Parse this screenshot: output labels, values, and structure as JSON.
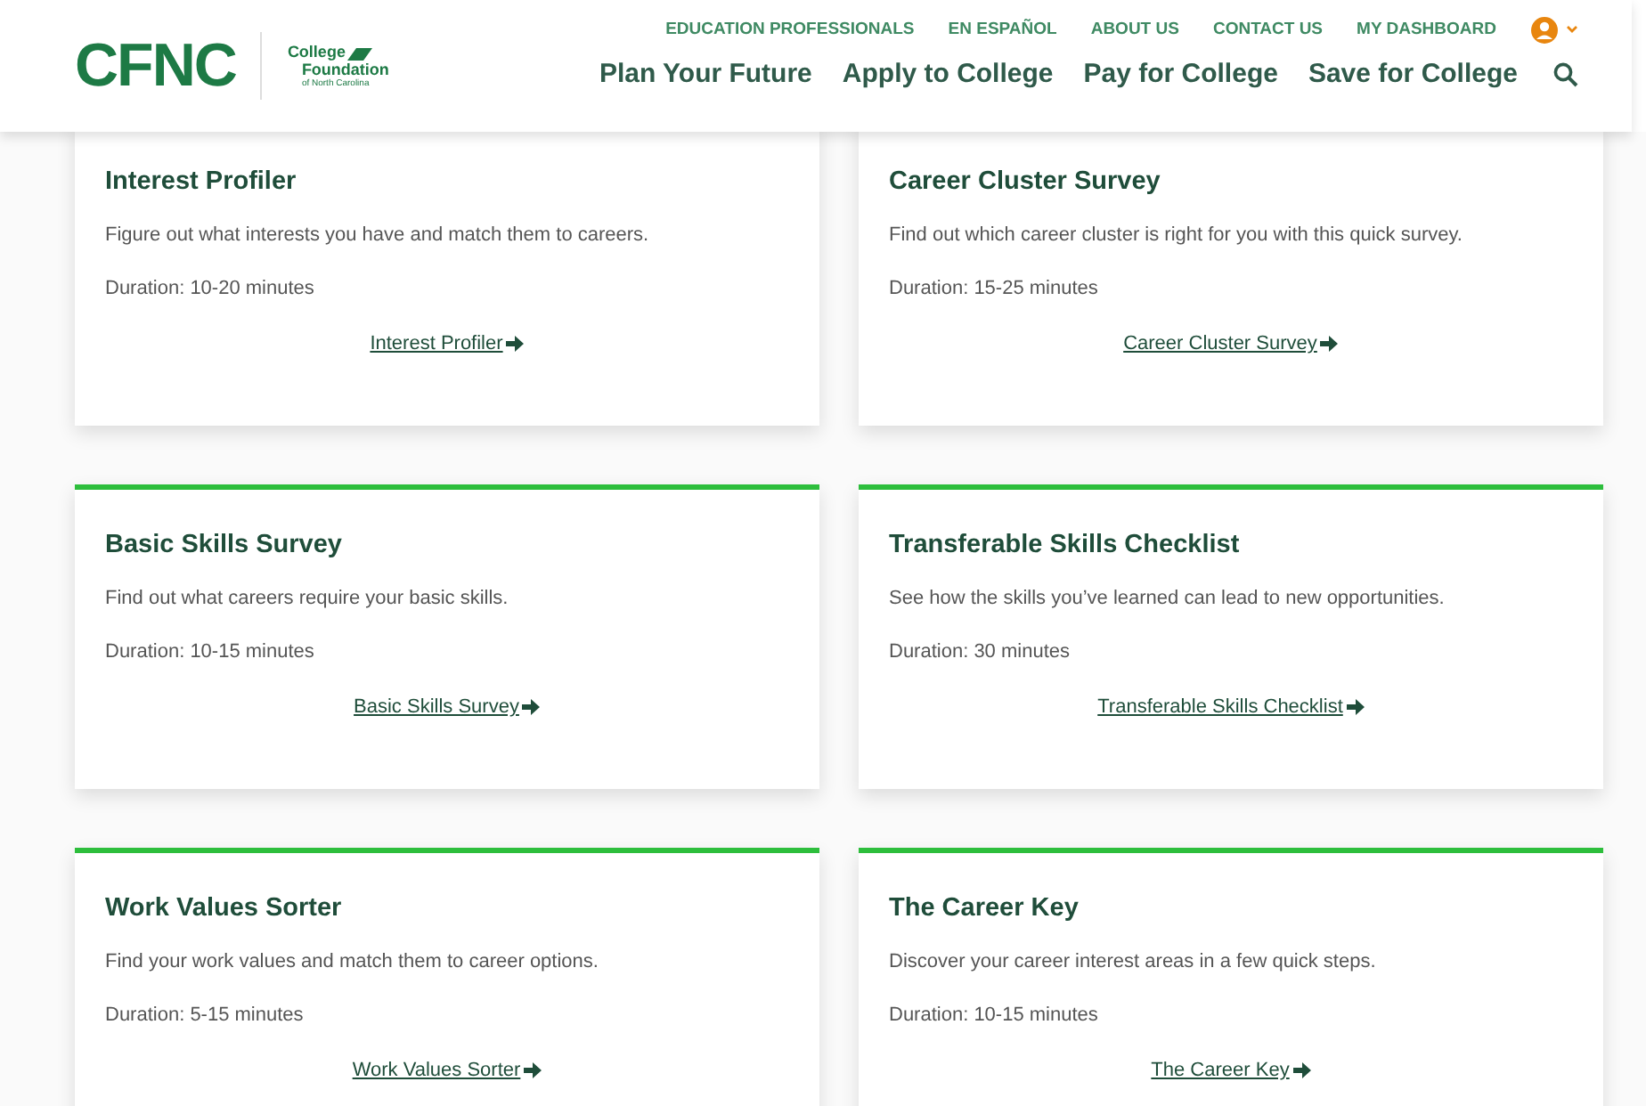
{
  "header": {
    "logo": "CFNC",
    "logo_sub": [
      "College",
      "Foundation",
      "of North Carolina"
    ],
    "utility_links": [
      "EDUCATION PROFESSIONALS",
      "EN ESPAÑOL",
      "ABOUT US",
      "CONTACT US",
      "MY DASHBOARD"
    ],
    "main_nav": [
      "Plan Your Future",
      "Apply to College",
      "Pay for College",
      "Save for College"
    ]
  },
  "cards": [
    {
      "title": "Interest Profiler",
      "description": "Figure out what interests you have and match them to careers.",
      "duration": "Duration: 10-20 minutes",
      "link": "Interest Profiler"
    },
    {
      "title": "Career Cluster Survey",
      "description": "Find out which career cluster is right for you with this quick survey.",
      "duration": "Duration: 15-25 minutes",
      "link": "Career Cluster Survey"
    },
    {
      "title": "Basic Skills Survey",
      "description": "Find out what careers require your basic skills.",
      "duration": "Duration: 10-15 minutes",
      "link": "Basic Skills Survey"
    },
    {
      "title": "Transferable Skills Checklist",
      "description": "See how the skills you’ve learned can lead to new opportunities.",
      "duration": "Duration: 30 minutes",
      "link": "Transferable Skills Checklist"
    },
    {
      "title": "Work Values Sorter",
      "description": "Find your work values and match them to career options.",
      "duration": "Duration: 5-15 minutes",
      "link": "Work Values Sorter"
    },
    {
      "title": "The Career Key",
      "description": "Discover your career interest areas in a few quick steps.",
      "duration": "Duration: 10-15 minutes",
      "link": "The Career Key"
    }
  ]
}
